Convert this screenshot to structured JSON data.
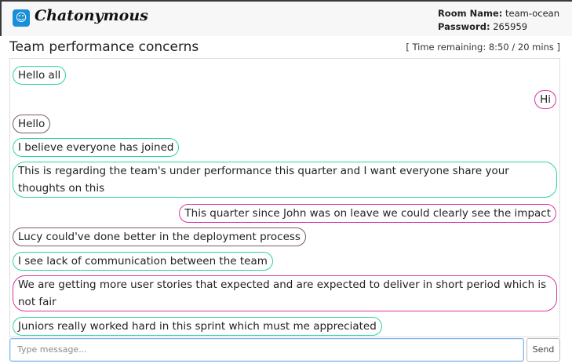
{
  "header": {
    "brand": "Chatonymous",
    "logo_icon": "chat-mask-icon"
  },
  "room": {
    "name_label": "Room Name:",
    "name_value": "team-ocean",
    "password_label": "Password:",
    "password_value": "265959"
  },
  "topic": {
    "title": "Team performance concerns",
    "timer": "[ Time remaining: 8:50 / 20 mins ]"
  },
  "messages": [
    {
      "text": "Hello all",
      "color": "green",
      "side": "left"
    },
    {
      "text": "Hi",
      "color": "pink",
      "side": "right"
    },
    {
      "text": "Hello",
      "color": "brown",
      "side": "left"
    },
    {
      "text": "I believe everyone has joined",
      "color": "green",
      "side": "left"
    },
    {
      "text": "This is regarding the team's under performance this quarter and I want everyone share your thoughts on this",
      "color": "green",
      "side": "left"
    },
    {
      "text": "This quarter since John was on leave we could clearly see the impact",
      "color": "pink",
      "side": "right"
    },
    {
      "text": "Lucy could've done better in the deployment process",
      "color": "brown",
      "side": "left"
    },
    {
      "text": "I see lack of communication between the team",
      "color": "green",
      "side": "left"
    },
    {
      "text": "We are getting more user stories that expected and are expected to deliver in short period which is not fair",
      "color": "pink",
      "side": "left"
    },
    {
      "text": "Juniors really worked hard in this sprint which must me appreciated",
      "color": "green",
      "side": "left"
    }
  ],
  "composer": {
    "placeholder": "Type message...",
    "send_label": "Send"
  },
  "colors": {
    "green": "#2fd3a1",
    "pink": "#d634a6",
    "brown": "#7a5c5c",
    "input_focus": "#7fb8ec"
  }
}
